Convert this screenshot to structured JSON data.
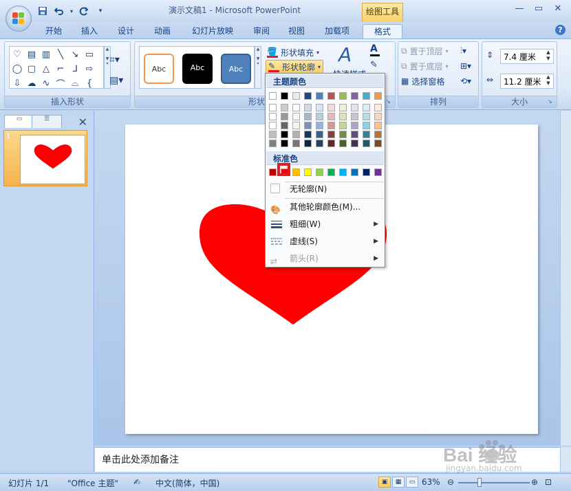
{
  "window": {
    "title": "演示文稿1 - Microsoft PowerPoint",
    "context_tool": "绘图工具",
    "controls": [
      "minimize",
      "maximize",
      "close"
    ]
  },
  "qat": {
    "icons": [
      "save-icon",
      "undo-icon",
      "redo-icon",
      "customize-icon"
    ]
  },
  "tabs": [
    "开始",
    "插入",
    "设计",
    "动画",
    "幻灯片放映",
    "审阅",
    "视图",
    "加载项",
    "格式"
  ],
  "active_tab": "格式",
  "ribbon": {
    "insert_shapes_label": "插入形状",
    "shape_styles_label": "形状样式",
    "style_samples": [
      "Abc",
      "Abc",
      "Abc"
    ],
    "fill_label": "形状填充",
    "outline_label": "形状轮廓",
    "quick_style_partial": "快速样式",
    "arrange_label": "排列",
    "bring_front": "置于顶层",
    "send_back": "置于底层",
    "selection_pane": "选择窗格",
    "size_label": "大小",
    "height": "7.4 厘米",
    "width": "11.2 厘米"
  },
  "slides_panel": {
    "thumb_number": "1"
  },
  "notes_placeholder": "单击此处添加备注",
  "status": {
    "slide": "幻灯片 1/1",
    "theme": "\"Office 主题\"",
    "language": "中文(简体，中国)",
    "zoom": "63%"
  },
  "dropdown": {
    "theme_colors_title": "主题颜色",
    "standard_colors_title": "标准色",
    "no_outline": "无轮廓(N)",
    "more_colors": "其他轮廓颜色(M)...",
    "weight": "粗细(W)",
    "dashes": "虚线(S)",
    "arrows": "箭头(R)",
    "selected_color": "#FF0000"
  },
  "colors": {
    "theme_top": [
      "#FFFFFF",
      "#000000",
      "#EEECE1",
      "#1F497D",
      "#4F81BD",
      "#C0504D",
      "#9BBB59",
      "#8064A2",
      "#4BACC6",
      "#F79646"
    ],
    "standard": [
      "#C00000",
      "#FF0000",
      "#FFC000",
      "#FFFF00",
      "#92D050",
      "#00B050",
      "#00B0F0",
      "#0070C0",
      "#002060",
      "#7030A0"
    ],
    "heart": "#FF0000"
  },
  "watermark": {
    "brand": "Bai 经验",
    "url": "jingyan.baidu.com"
  }
}
